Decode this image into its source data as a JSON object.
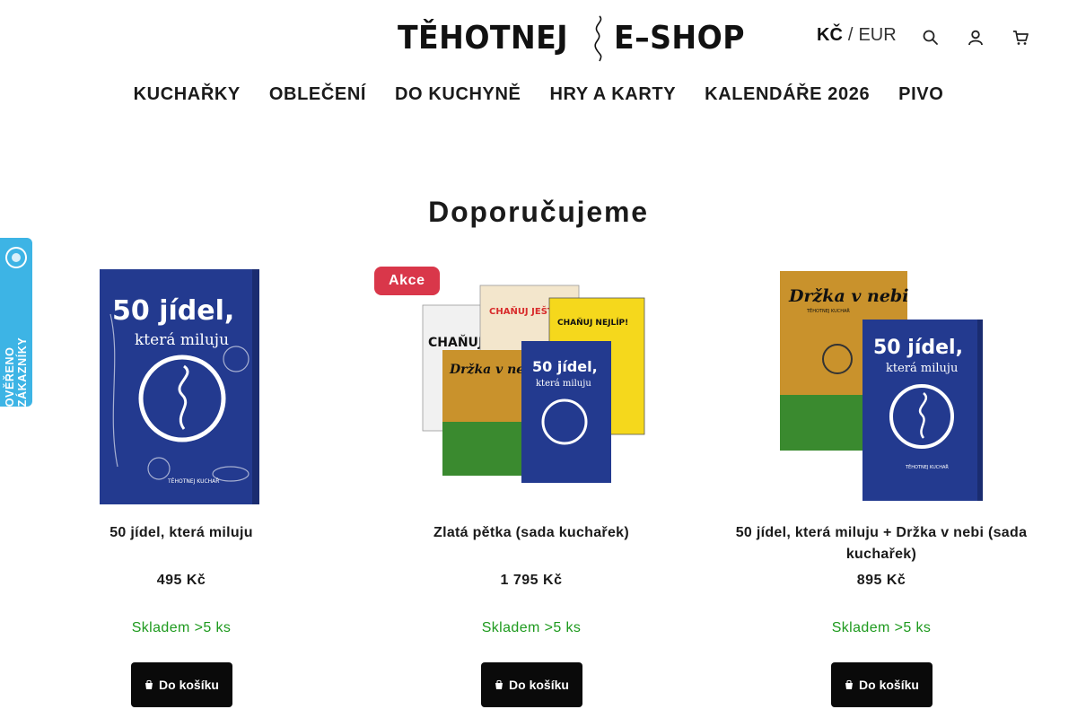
{
  "header": {
    "logo_left": "TĚHOTNEJ",
    "logo_right": "E–SHOP",
    "currency_active": "KČ",
    "currency_separator": "/",
    "currency_inactive": "EUR",
    "icons": [
      "search-icon",
      "user-icon",
      "cart-icon"
    ]
  },
  "nav": {
    "items": [
      {
        "label": "KUCHAŘKY"
      },
      {
        "label": "OBLEČENÍ"
      },
      {
        "label": "DO KUCHYNĚ"
      },
      {
        "label": "HRY A KARTY"
      },
      {
        "label": "KALENDÁŘE 2026"
      },
      {
        "label": "PIVO"
      }
    ]
  },
  "side_widget": {
    "text": "OVĚŘENO ZÁKAZNÍKY"
  },
  "section": {
    "title": "Doporučujeme"
  },
  "products": [
    {
      "name": "50 jídel, která miluju",
      "price": "495 Kč",
      "stock": "Skladem >5 ks",
      "button": "Do košíku",
      "badge": "",
      "cover_title_1": "50 jídel,",
      "cover_title_2": "která miluju",
      "cover_author": "TĚHOTNEJ KUCHAŘ"
    },
    {
      "name": "Zlatá pětka (sada kuchařek)",
      "price": "1 795 Kč",
      "stock": "Skladem >5 ks",
      "button": "Do košíku",
      "badge": "Akce",
      "cover_a": "CHAŇUJ",
      "cover_b": "CHAŇUJ JEŠTĚ LÍP!",
      "cover_c": "CHAŇUJ NEJLÍP!",
      "cover_d": "Držka v nebi",
      "cover_e": "50 jídel,",
      "cover_e2": "která miluju"
    },
    {
      "name": "50 jídel, která miluju + Držka v nebi (sada kuchařek)",
      "price": "895 Kč",
      "stock": "Skladem >5 ks",
      "button": "Do košíku",
      "badge": "",
      "cover_a": "Držka v nebi",
      "cover_a_sub": "TĚHOTNEJ KUCHAŘ",
      "cover_b": "50 jídel,",
      "cover_b2": "která miluju",
      "cover_b_author": "TĚHOTNEJ KUCHAŘ"
    }
  ],
  "colors": {
    "navy_cover": "#233a8f",
    "stock_green": "#1e9a1e",
    "badge_red": "#d9374a",
    "widget_blue": "#3db4e5",
    "button_black": "#0a0a0a"
  }
}
